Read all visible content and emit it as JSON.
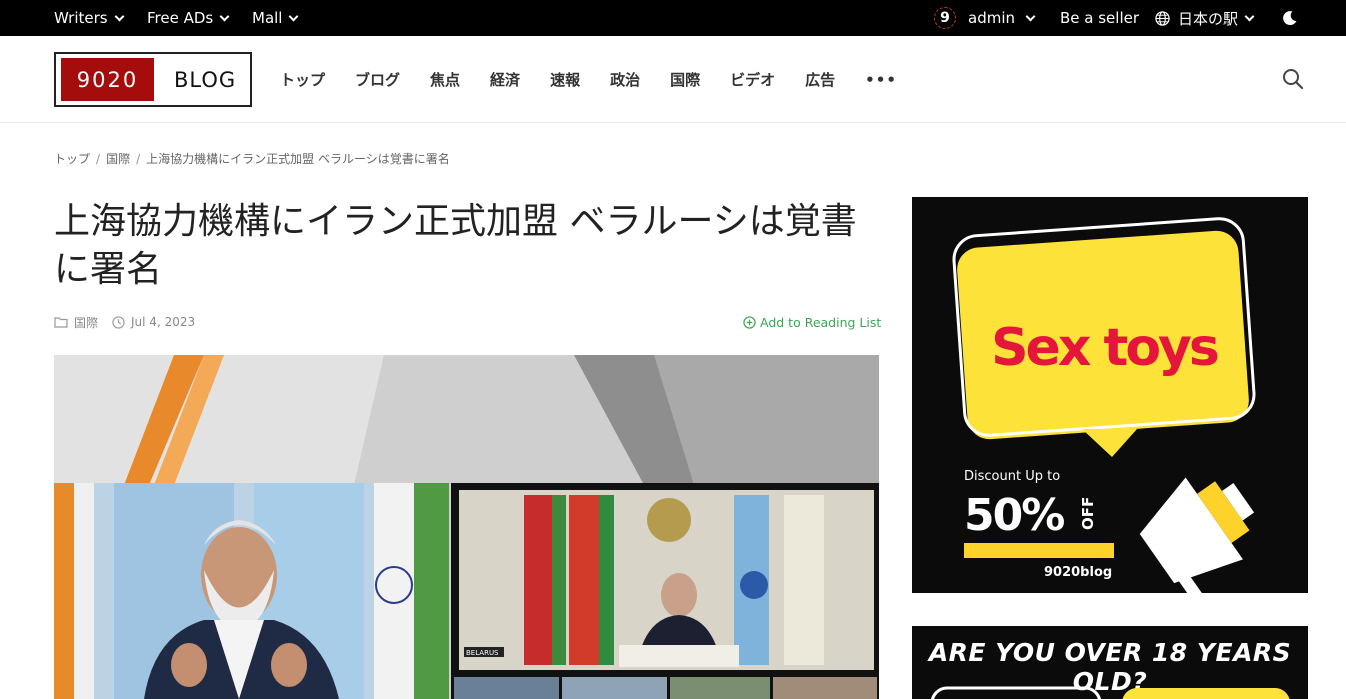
{
  "topbar": {
    "writers": "Writers",
    "free_ads": "Free ADs",
    "mall": "Mall",
    "avatar_digit": "9",
    "user": "admin",
    "be_seller": "Be a seller",
    "language": "日本の駅"
  },
  "header": {
    "logo_number": "9020",
    "logo_text": "BLOG",
    "nav": [
      "トップ",
      "ブログ",
      "焦点",
      "経済",
      "速報",
      "政治",
      "国際",
      "ビデオ",
      "広告"
    ],
    "more": "•••"
  },
  "breadcrumb": {
    "home": "トップ",
    "category": "国際",
    "current": "上海協力機構にイラン正式加盟 ベラルーシは覚書に署名"
  },
  "article": {
    "title": "上海協力機構にイラン正式加盟 ベラルーシは覚書に署名",
    "category": "国際",
    "date": "Jul 4, 2023",
    "reading_list": "Add to Reading List",
    "hero_label": "BELARUS"
  },
  "ads": {
    "ad1_headline": "Sex toys",
    "ad1_discount_label": "Discount Up to",
    "ad1_percent": "50%",
    "ad1_off": "OFF",
    "ad1_brand": "9020blog",
    "ad2_headline": "ARE YOU OVER 18 YEARS OLD?"
  },
  "colors": {
    "logo_red": "#a50d0d",
    "accent_green": "#3aa655",
    "ad_yellow": "#fde23a",
    "ad_red": "#e4173b"
  }
}
